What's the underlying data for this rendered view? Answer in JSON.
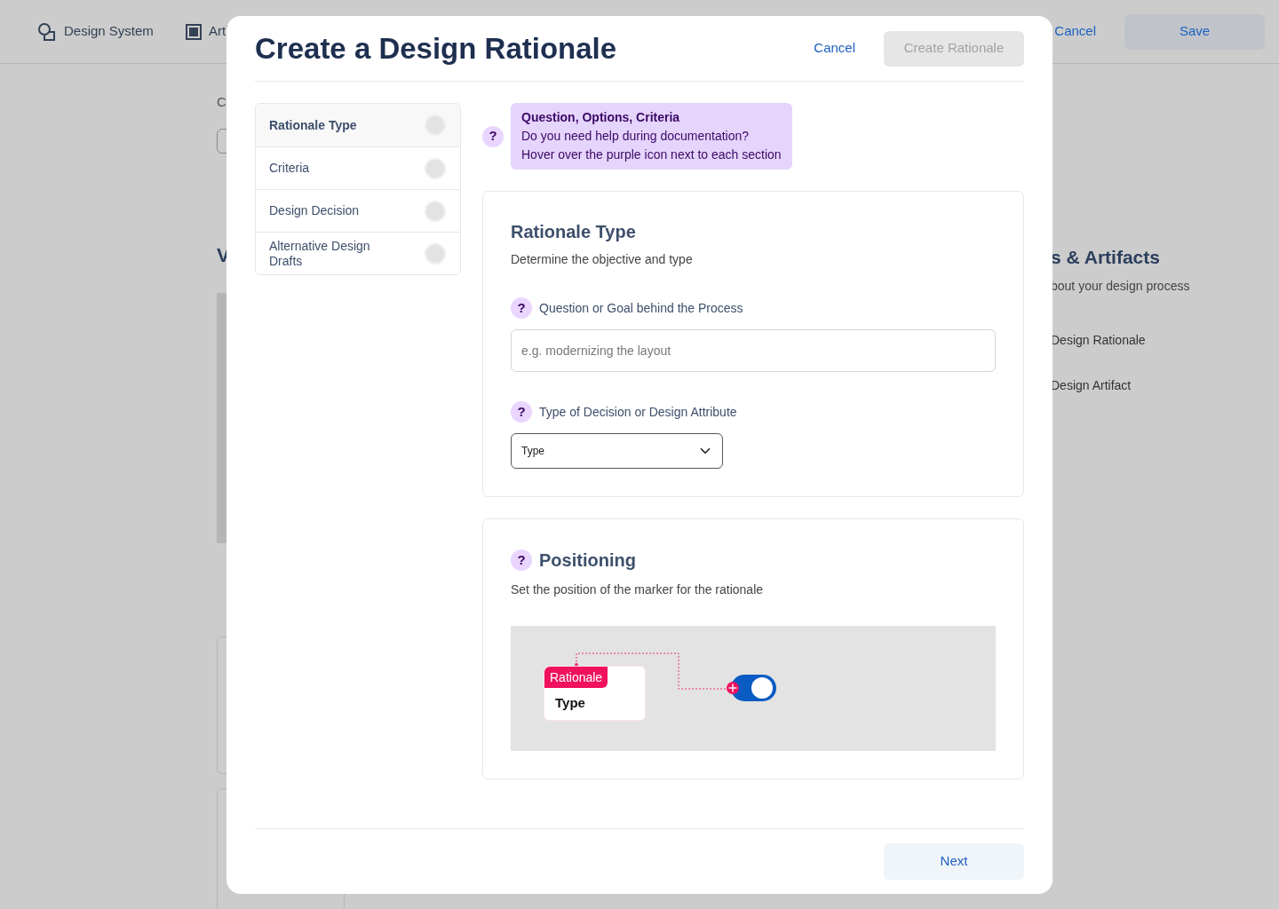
{
  "background": {
    "nav": [
      {
        "label": "Design System"
      },
      {
        "label": "Arti"
      }
    ],
    "actions": {
      "cancel": "Cancel",
      "save": "Save"
    },
    "left": {
      "label_1": "C",
      "heading_1": "V"
    },
    "right": {
      "heading": "s & Artifacts",
      "subtitle": "bout your design process",
      "items": [
        "Design Rationale",
        "Design Artifact"
      ]
    }
  },
  "dialog": {
    "title": "Create a Design Rationale",
    "cancel": "Cancel",
    "create": {
      "label": "Create Rationale",
      "disabled": true
    },
    "steps": [
      {
        "label": "Rationale Type",
        "selected": true
      },
      {
        "label": "Criteria",
        "selected": false
      },
      {
        "label": "Design Decision",
        "selected": false
      },
      {
        "label": "Alternative Design Drafts",
        "selected": false
      }
    ],
    "help": {
      "icon": "?",
      "title": "Question, Options, Criteria",
      "lines": [
        "Do you need help during documentation?",
        "Hover over the purple icon next to each section"
      ]
    },
    "rationale_type": {
      "title": "Rationale Type",
      "subtitle": "Determine the objective and type",
      "question": {
        "help": "?",
        "label": "Question or Goal behind the Process",
        "placeholder": "e.g. modernizing the layout"
      },
      "type": {
        "help": "?",
        "label": "Type of Decision or Design Attribute",
        "value": "Type"
      }
    },
    "positioning": {
      "help": "?",
      "title": "Positioning",
      "subtitle": "Set the position of the marker for the rationale",
      "preview": {
        "tag": "Rationale",
        "label": "Type"
      }
    },
    "next": "Next"
  }
}
